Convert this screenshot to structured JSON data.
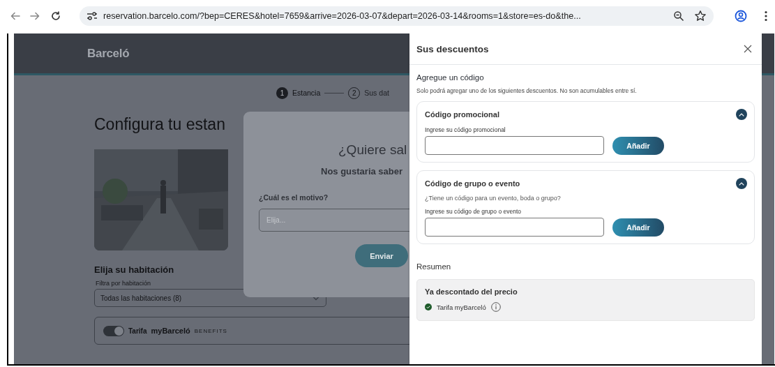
{
  "browser": {
    "url": "reservation.barcelo.com/?bep=CERES&hotel=7659&arrive=2026-03-07&depart=2026-03-14&rooms=1&store=es-do&the..."
  },
  "page": {
    "logo": "Barceló",
    "steps": [
      {
        "number": "1",
        "label": "Estancia",
        "selected": true
      },
      {
        "number": "2",
        "label": "Sus dat",
        "selected": false
      }
    ],
    "title": "Configura tu estan",
    "room_heading": "Elija su habitación",
    "filter_label": "Filtra por habitación",
    "filter_value": "Todas las habitaciones (8)",
    "rate_toggle": {
      "on": true,
      "label": "Tarifa",
      "brand": "myBarceló",
      "brand_tag": "BENEFITS"
    }
  },
  "survey_modal": {
    "title": "¿Quiere sal",
    "subtitle": "Nos gustaria saber",
    "question": "¿Cuál es el motivo?",
    "placeholder": "Elija...",
    "submit": "Enviar"
  },
  "discounts_panel": {
    "title": "Sus descuentos",
    "add_heading": "Agregue un código",
    "note": "Solo podrá agregar uno de los siguientes descuentos. No son acumulables entre sí.",
    "sections": [
      {
        "title": "Código promocional",
        "expanded": true,
        "field_label": "Ingrese su código promocional",
        "button": "Añadir"
      },
      {
        "title": "Código de grupo o evento",
        "expanded": true,
        "description": "¿Tiene un código para un evento, boda o grupo?",
        "field_label": "Ingrese su código de grupo o evento",
        "button": "Añadir"
      }
    ],
    "summary_heading": "Resumen",
    "summary": {
      "title": "Ya descontado del precio",
      "items": [
        {
          "label": "Tarifa myBarceló",
          "applied": true
        }
      ]
    }
  }
}
